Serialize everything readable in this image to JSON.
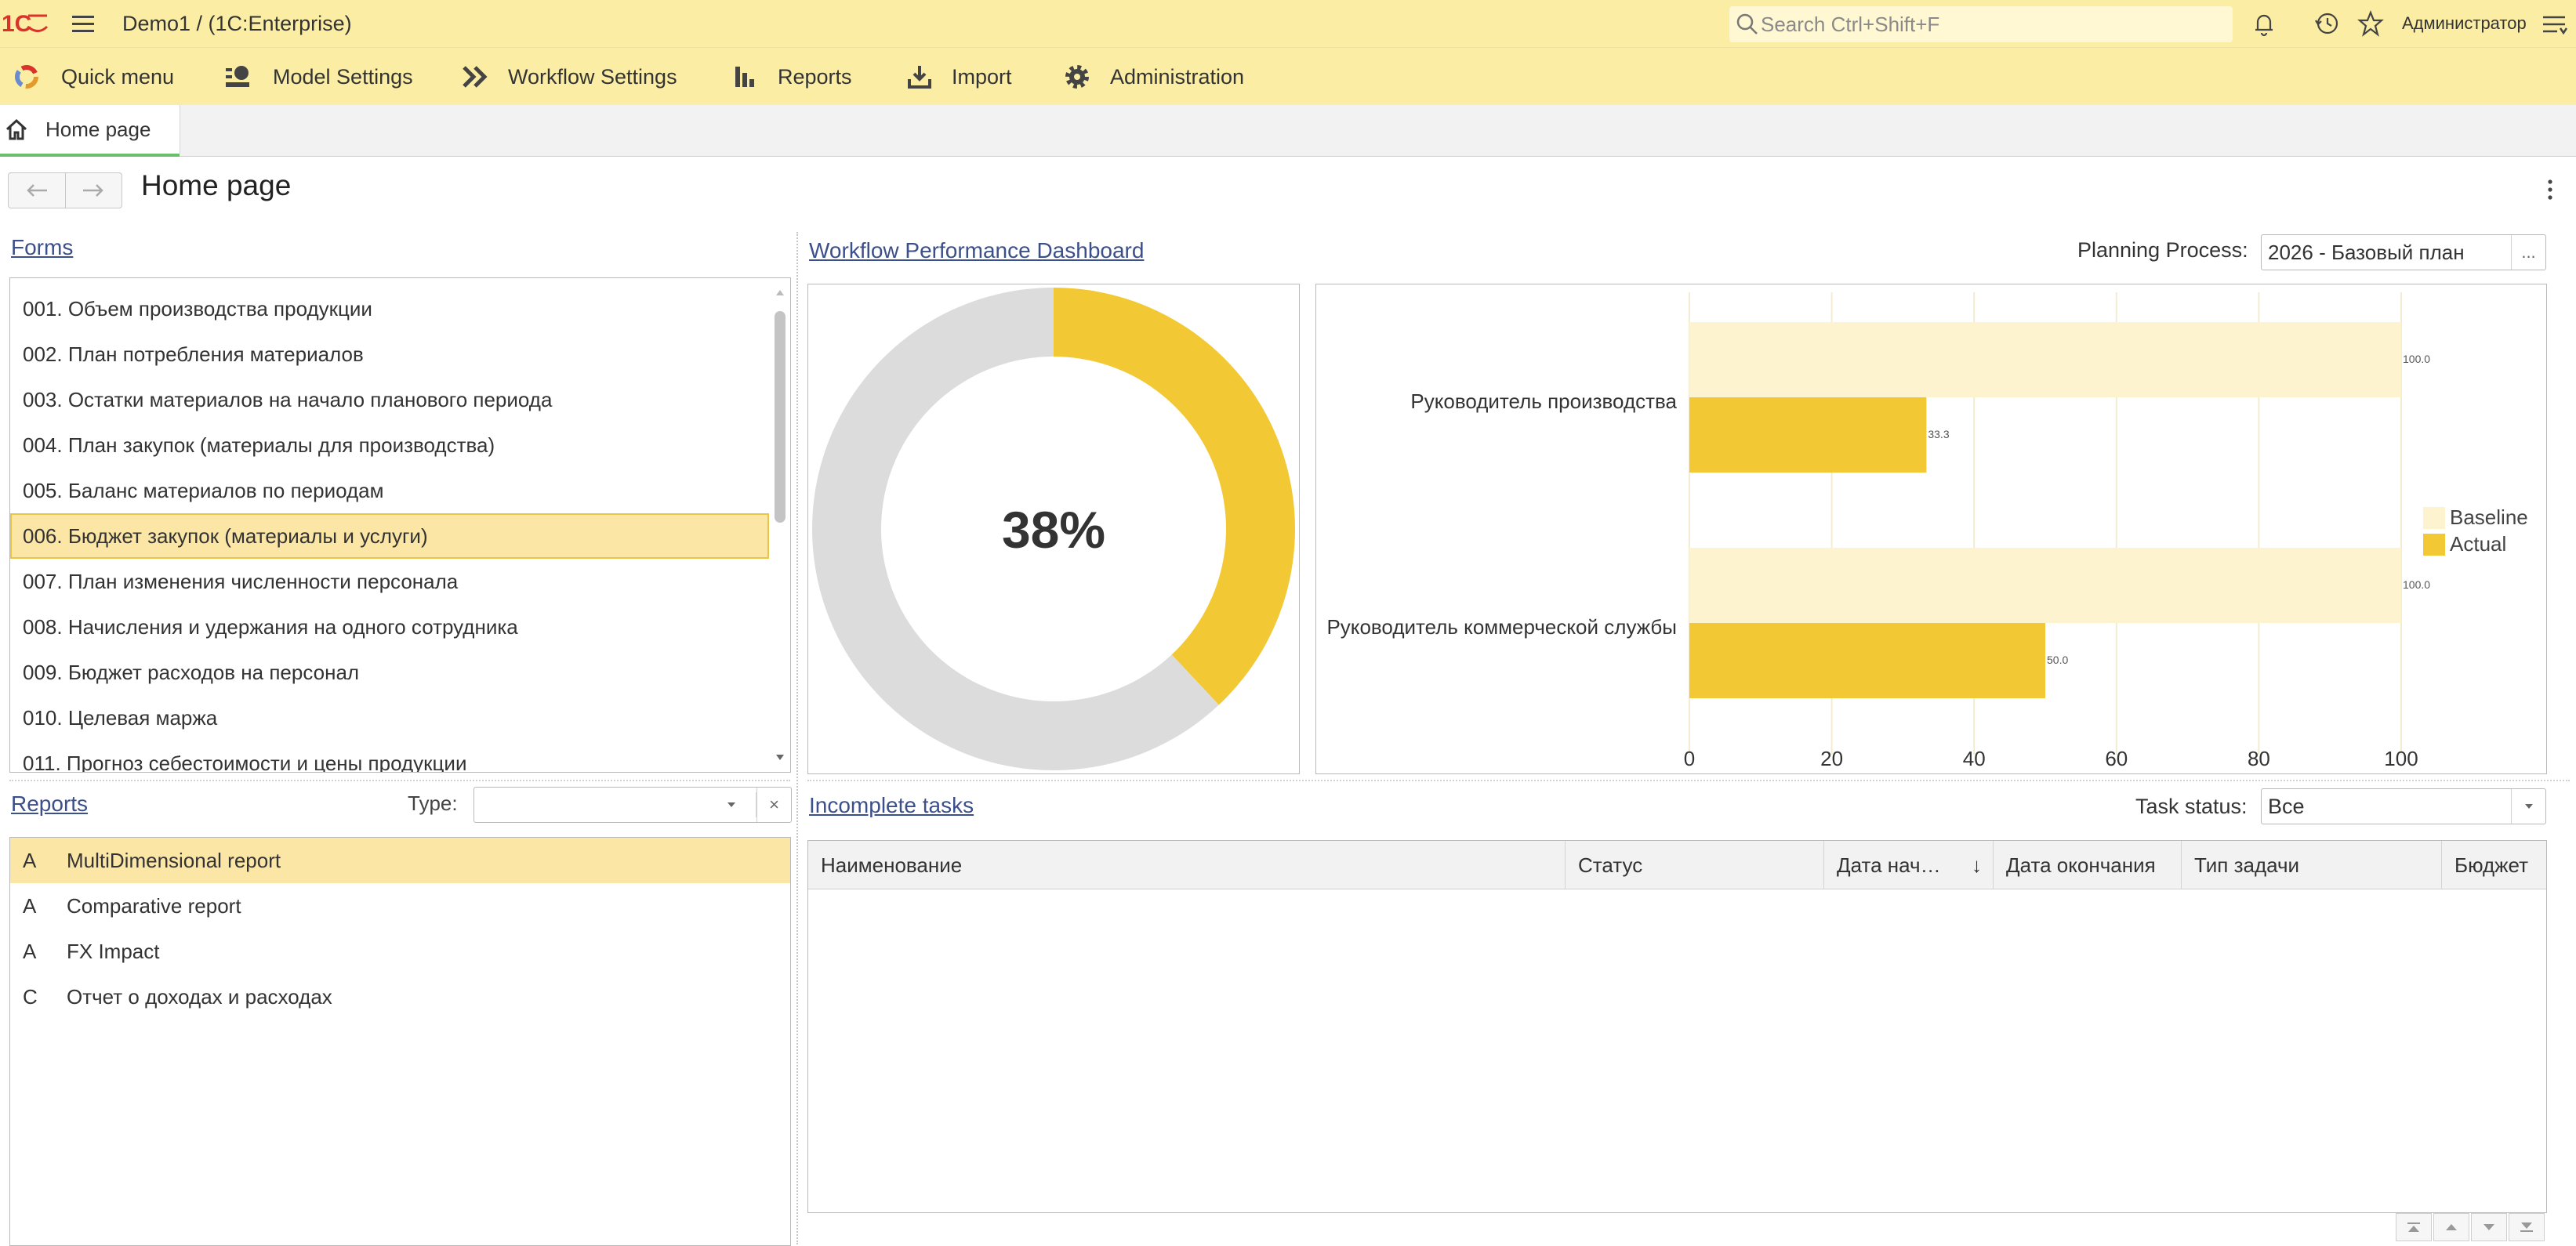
{
  "app": {
    "title": "Demo1 /  (1C:Enterprise)",
    "search_placeholder": "Search Ctrl+Shift+F",
    "user": "Администратор",
    "brand_color": "#fbeea4",
    "accent_color": "#f2c935"
  },
  "sections": [
    {
      "label": "Quick menu",
      "icon": "quick-menu-icon"
    },
    {
      "label": "Model Settings",
      "icon": "model-settings-icon"
    },
    {
      "label": "Workflow Settings",
      "icon": "workflow-settings-icon"
    },
    {
      "label": "Reports",
      "icon": "reports-icon"
    },
    {
      "label": "Import",
      "icon": "import-icon"
    },
    {
      "label": "Administration",
      "icon": "gear-icon"
    }
  ],
  "open_tabs": [
    {
      "label": "Home page",
      "icon": "home-icon"
    }
  ],
  "page": {
    "title": "Home page"
  },
  "forms": {
    "title": "Forms",
    "items": [
      "001. Объем производства продукции",
      "002. План потребления материалов",
      "003. Остатки материалов на начало планового периода",
      "004. План закупок (материалы для производства)",
      "005. Баланс материалов по периодам",
      "006. Бюджет закупок (материалы и услуги)",
      "007. План изменения численности персонала",
      "008. Начисления и удержания на одного сотрудника",
      "009. Бюджет расходов на персонал",
      "010. Целевая маржа",
      "011. Прогноз себестоимости и цены продукции"
    ],
    "selected_index": 5
  },
  "reports": {
    "title": "Reports",
    "type_label": "Type:",
    "type_value": "",
    "clear_label": "×",
    "items": [
      {
        "kind": "A",
        "name": "MultiDimensional report"
      },
      {
        "kind": "A",
        "name": "Comparative report"
      },
      {
        "kind": "A",
        "name": "FX Impact"
      },
      {
        "kind": "C",
        "name": "Отчет о доходах и расходах"
      }
    ],
    "selected_index": 0
  },
  "dashboard": {
    "title": "Workflow Performance Dashboard",
    "planning_label": "Planning Process:",
    "planning_value": "2026 - Базовый план",
    "planning_button": "..."
  },
  "chart_data": [
    {
      "type": "pie",
      "variant": "donut",
      "center_label": "38%",
      "values": [
        38,
        62
      ],
      "colors": [
        "#f2c935",
        "#dcdcdc"
      ]
    },
    {
      "type": "bar",
      "orientation": "horizontal",
      "categories": [
        "Руководитель производства",
        "Руководитель коммерческой службы"
      ],
      "series": [
        {
          "name": "Baseline",
          "values": [
            100.0,
            100.0
          ],
          "color": "#fdf3cf",
          "labels": [
            "100.0",
            "100.0"
          ]
        },
        {
          "name": "Actual",
          "values": [
            33.3,
            50.0
          ],
          "color": "#f2c935",
          "labels": [
            "33.3",
            "50.0"
          ]
        }
      ],
      "xlim": [
        0,
        100
      ],
      "xticks": [
        "0",
        "20",
        "40",
        "60",
        "80",
        "100"
      ],
      "legend_position": "right",
      "grid": true
    }
  ],
  "tasks": {
    "title": "Incomplete tasks",
    "status_label": "Task status:",
    "status_value": "Все",
    "columns": [
      "Наименование",
      "Статус",
      "Дата нач…",
      "Дата окончания",
      "Тип задачи",
      "Бюджет"
    ],
    "sort_indicator": "↓",
    "rows": []
  }
}
